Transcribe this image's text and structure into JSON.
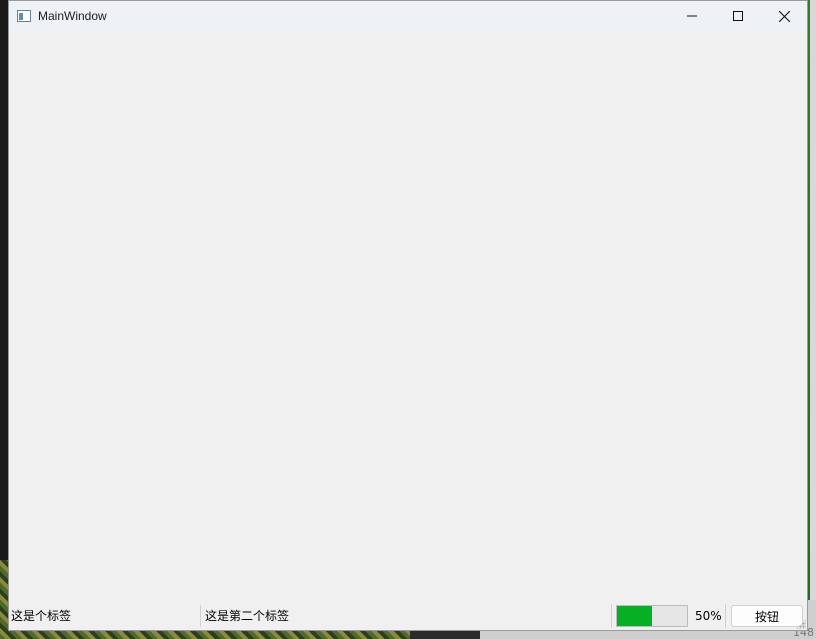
{
  "window": {
    "title": "MainWindow",
    "icon": "app-window-icon"
  },
  "titlebar_buttons": {
    "minimize_icon": "minimize-icon",
    "maximize_icon": "maximize-icon",
    "close_icon": "close-icon"
  },
  "statusbar": {
    "label1": "这是个标签",
    "label2": "这是第二个标签",
    "progress_value": 50,
    "progress_text": "50%",
    "progress_color": "#06b025",
    "button_label": "按钮"
  },
  "desktop": {
    "corner_number": "148"
  }
}
